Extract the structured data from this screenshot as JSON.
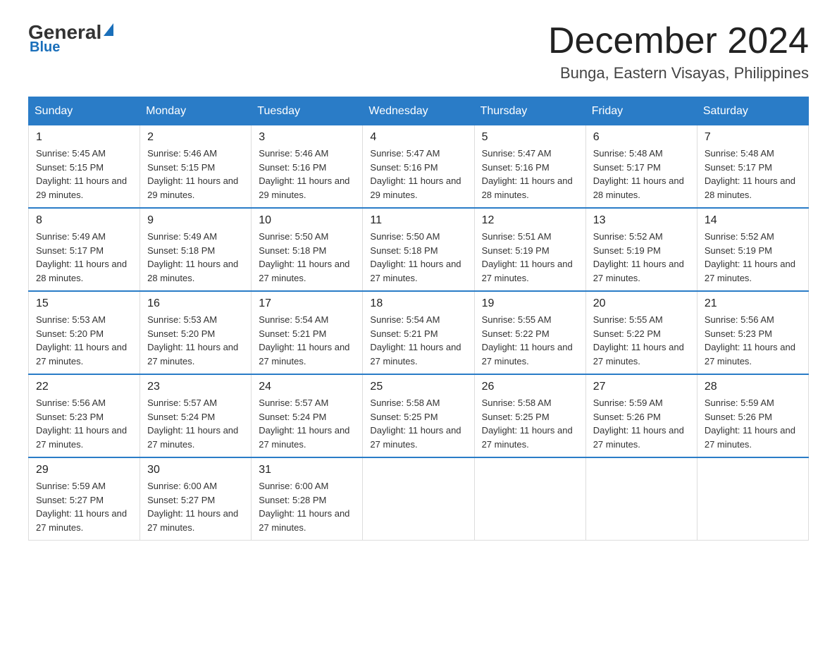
{
  "logo": {
    "general": "General",
    "blue": "Blue"
  },
  "title": "December 2024",
  "subtitle": "Bunga, Eastern Visayas, Philippines",
  "days_of_week": [
    "Sunday",
    "Monday",
    "Tuesday",
    "Wednesday",
    "Thursday",
    "Friday",
    "Saturday"
  ],
  "weeks": [
    [
      {
        "day": "1",
        "sunrise": "5:45 AM",
        "sunset": "5:15 PM",
        "daylight": "11 hours and 29 minutes."
      },
      {
        "day": "2",
        "sunrise": "5:46 AM",
        "sunset": "5:15 PM",
        "daylight": "11 hours and 29 minutes."
      },
      {
        "day": "3",
        "sunrise": "5:46 AM",
        "sunset": "5:16 PM",
        "daylight": "11 hours and 29 minutes."
      },
      {
        "day": "4",
        "sunrise": "5:47 AM",
        "sunset": "5:16 PM",
        "daylight": "11 hours and 29 minutes."
      },
      {
        "day": "5",
        "sunrise": "5:47 AM",
        "sunset": "5:16 PM",
        "daylight": "11 hours and 28 minutes."
      },
      {
        "day": "6",
        "sunrise": "5:48 AM",
        "sunset": "5:17 PM",
        "daylight": "11 hours and 28 minutes."
      },
      {
        "day": "7",
        "sunrise": "5:48 AM",
        "sunset": "5:17 PM",
        "daylight": "11 hours and 28 minutes."
      }
    ],
    [
      {
        "day": "8",
        "sunrise": "5:49 AM",
        "sunset": "5:17 PM",
        "daylight": "11 hours and 28 minutes."
      },
      {
        "day": "9",
        "sunrise": "5:49 AM",
        "sunset": "5:18 PM",
        "daylight": "11 hours and 28 minutes."
      },
      {
        "day": "10",
        "sunrise": "5:50 AM",
        "sunset": "5:18 PM",
        "daylight": "11 hours and 27 minutes."
      },
      {
        "day": "11",
        "sunrise": "5:50 AM",
        "sunset": "5:18 PM",
        "daylight": "11 hours and 27 minutes."
      },
      {
        "day": "12",
        "sunrise": "5:51 AM",
        "sunset": "5:19 PM",
        "daylight": "11 hours and 27 minutes."
      },
      {
        "day": "13",
        "sunrise": "5:52 AM",
        "sunset": "5:19 PM",
        "daylight": "11 hours and 27 minutes."
      },
      {
        "day": "14",
        "sunrise": "5:52 AM",
        "sunset": "5:19 PM",
        "daylight": "11 hours and 27 minutes."
      }
    ],
    [
      {
        "day": "15",
        "sunrise": "5:53 AM",
        "sunset": "5:20 PM",
        "daylight": "11 hours and 27 minutes."
      },
      {
        "day": "16",
        "sunrise": "5:53 AM",
        "sunset": "5:20 PM",
        "daylight": "11 hours and 27 minutes."
      },
      {
        "day": "17",
        "sunrise": "5:54 AM",
        "sunset": "5:21 PM",
        "daylight": "11 hours and 27 minutes."
      },
      {
        "day": "18",
        "sunrise": "5:54 AM",
        "sunset": "5:21 PM",
        "daylight": "11 hours and 27 minutes."
      },
      {
        "day": "19",
        "sunrise": "5:55 AM",
        "sunset": "5:22 PM",
        "daylight": "11 hours and 27 minutes."
      },
      {
        "day": "20",
        "sunrise": "5:55 AM",
        "sunset": "5:22 PM",
        "daylight": "11 hours and 27 minutes."
      },
      {
        "day": "21",
        "sunrise": "5:56 AM",
        "sunset": "5:23 PM",
        "daylight": "11 hours and 27 minutes."
      }
    ],
    [
      {
        "day": "22",
        "sunrise": "5:56 AM",
        "sunset": "5:23 PM",
        "daylight": "11 hours and 27 minutes."
      },
      {
        "day": "23",
        "sunrise": "5:57 AM",
        "sunset": "5:24 PM",
        "daylight": "11 hours and 27 minutes."
      },
      {
        "day": "24",
        "sunrise": "5:57 AM",
        "sunset": "5:24 PM",
        "daylight": "11 hours and 27 minutes."
      },
      {
        "day": "25",
        "sunrise": "5:58 AM",
        "sunset": "5:25 PM",
        "daylight": "11 hours and 27 minutes."
      },
      {
        "day": "26",
        "sunrise": "5:58 AM",
        "sunset": "5:25 PM",
        "daylight": "11 hours and 27 minutes."
      },
      {
        "day": "27",
        "sunrise": "5:59 AM",
        "sunset": "5:26 PM",
        "daylight": "11 hours and 27 minutes."
      },
      {
        "day": "28",
        "sunrise": "5:59 AM",
        "sunset": "5:26 PM",
        "daylight": "11 hours and 27 minutes."
      }
    ],
    [
      {
        "day": "29",
        "sunrise": "5:59 AM",
        "sunset": "5:27 PM",
        "daylight": "11 hours and 27 minutes."
      },
      {
        "day": "30",
        "sunrise": "6:00 AM",
        "sunset": "5:27 PM",
        "daylight": "11 hours and 27 minutes."
      },
      {
        "day": "31",
        "sunrise": "6:00 AM",
        "sunset": "5:28 PM",
        "daylight": "11 hours and 27 minutes."
      },
      null,
      null,
      null,
      null
    ]
  ],
  "labels": {
    "sunrise": "Sunrise:",
    "sunset": "Sunset:",
    "daylight": "Daylight:"
  }
}
